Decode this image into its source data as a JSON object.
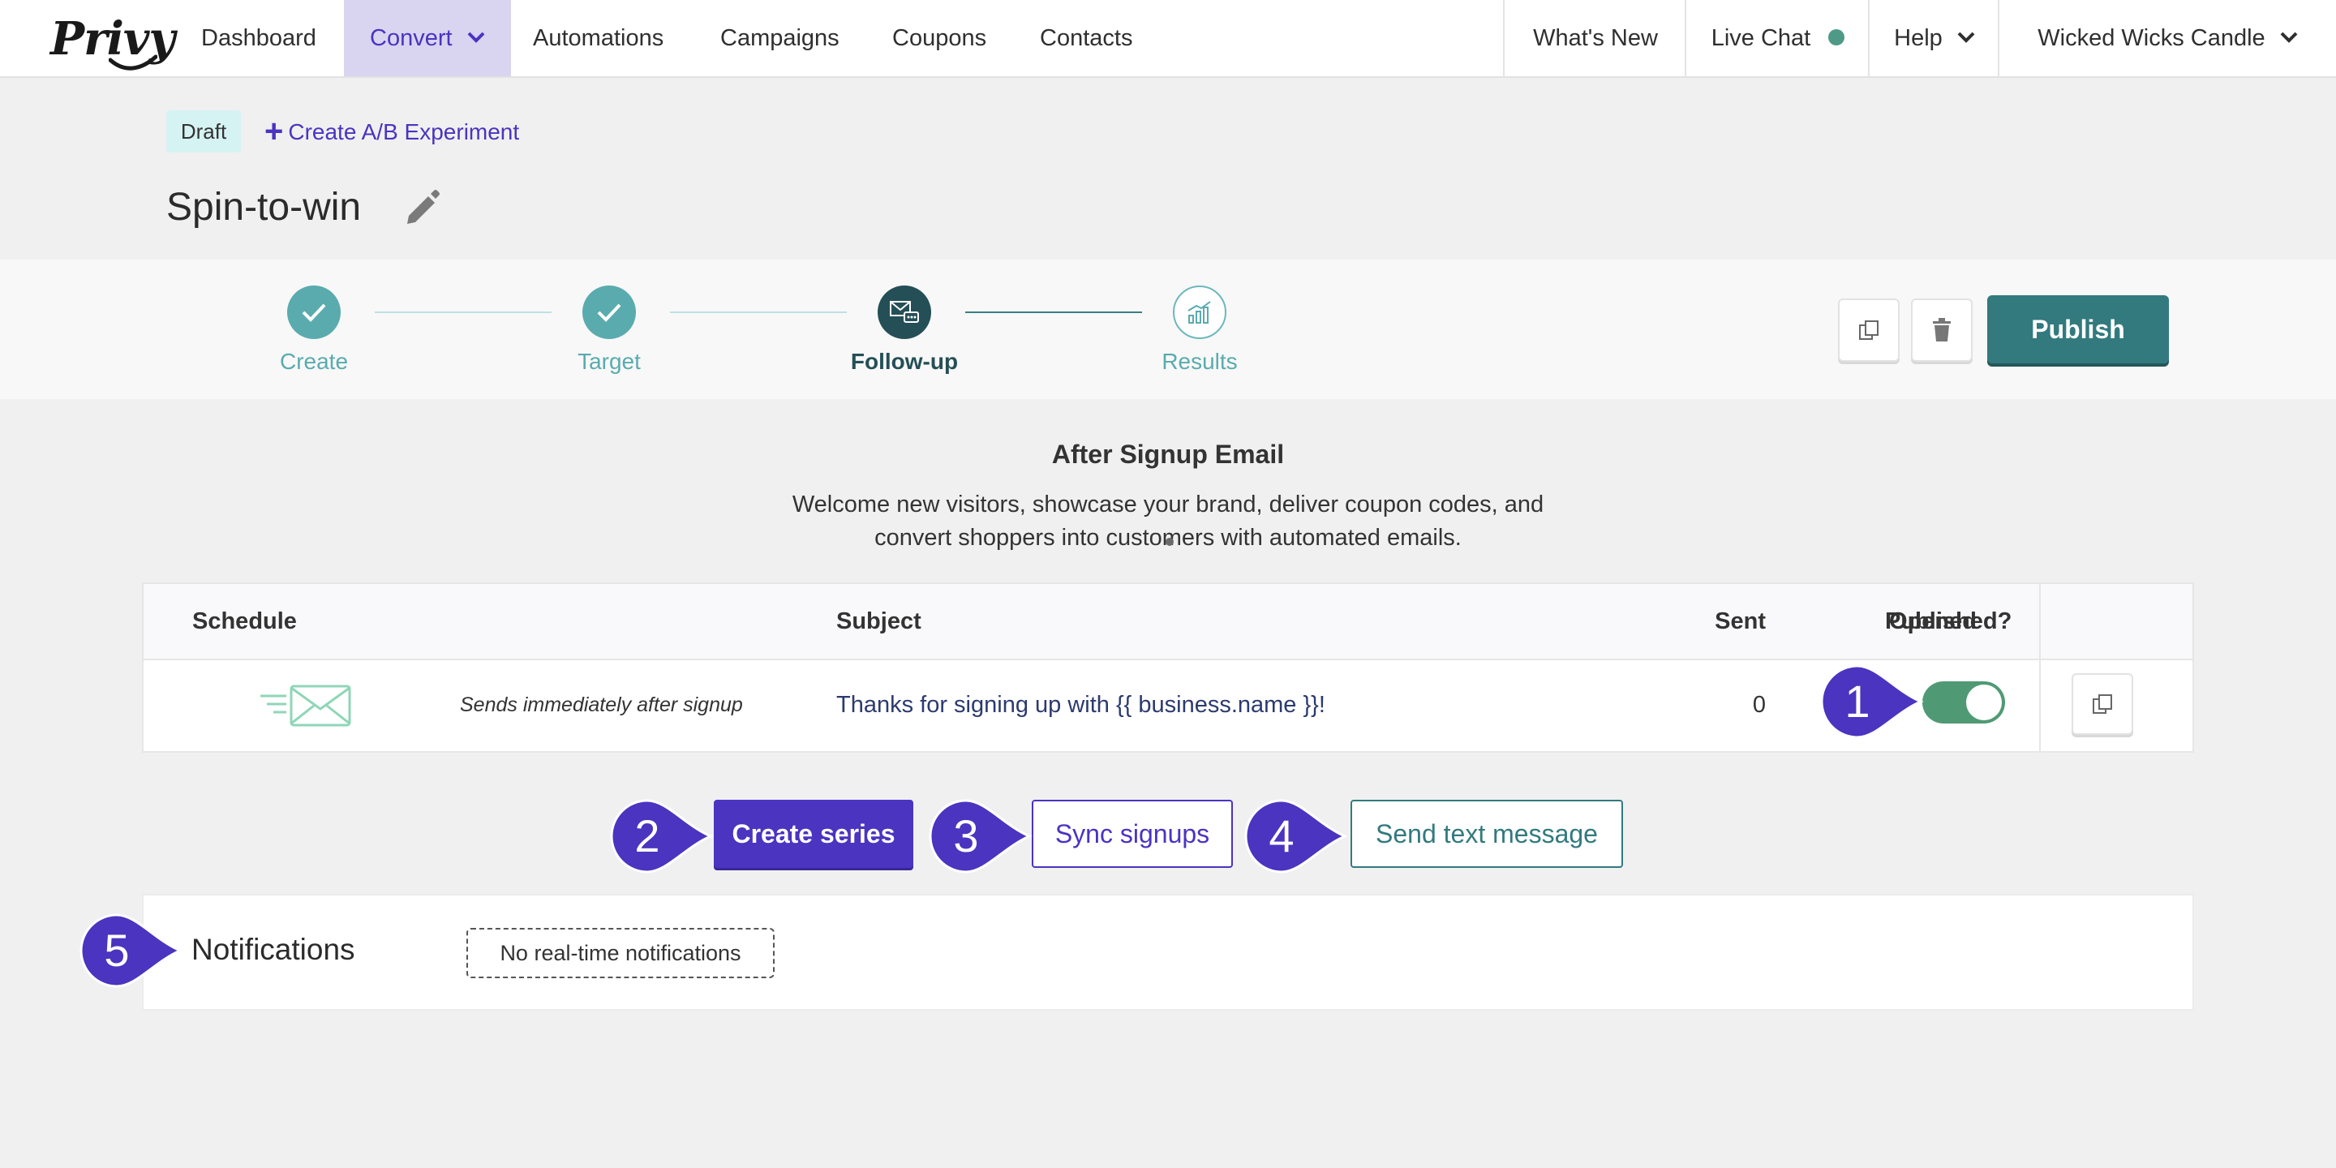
{
  "nav": {
    "logo": "Privy",
    "items": [
      "Dashboard",
      "Convert",
      "Automations",
      "Campaigns",
      "Coupons",
      "Contacts"
    ],
    "right_items": [
      "What's New",
      "Live Chat",
      "Help",
      "Wicked Wicks Candle"
    ]
  },
  "header": {
    "status_badge": "Draft",
    "ab_link": "Create A/B Experiment",
    "ab_plus": "+",
    "title": "Spin-to-win"
  },
  "stepper": {
    "steps": [
      {
        "label": "Create",
        "state": "done"
      },
      {
        "label": "Target",
        "state": "done"
      },
      {
        "label": "Follow-up",
        "state": "current"
      },
      {
        "label": "Results",
        "state": "future"
      }
    ],
    "publish_label": "Publish"
  },
  "email_section": {
    "title": "After Signup Email",
    "description": "Welcome new visitors, showcase your brand, deliver coupon codes, and convert shoppers into customers with automated emails."
  },
  "table": {
    "headers": [
      "Schedule",
      "Subject",
      "Sent",
      "Opened",
      "Published?"
    ],
    "rows": [
      {
        "schedule": "Sends immediately after signup",
        "subject": "Thanks for signing up with {{ business.name }}!",
        "sent": "0",
        "opened": "",
        "published": true
      }
    ]
  },
  "actions": {
    "create_series": "Create series",
    "sync_signups": "Sync signups",
    "send_text": "Send text message"
  },
  "notifications": {
    "title": "Notifications",
    "empty_label": "No real-time notifications"
  },
  "markers": [
    "1",
    "2",
    "3",
    "4",
    "5"
  ],
  "colors": {
    "brand_purple": "#4a34c0",
    "teal": "#327a7e",
    "step_done": "#5aabae",
    "step_current": "#254f56",
    "toggle_on": "#4f9a74",
    "marker": "#4a34c0"
  }
}
